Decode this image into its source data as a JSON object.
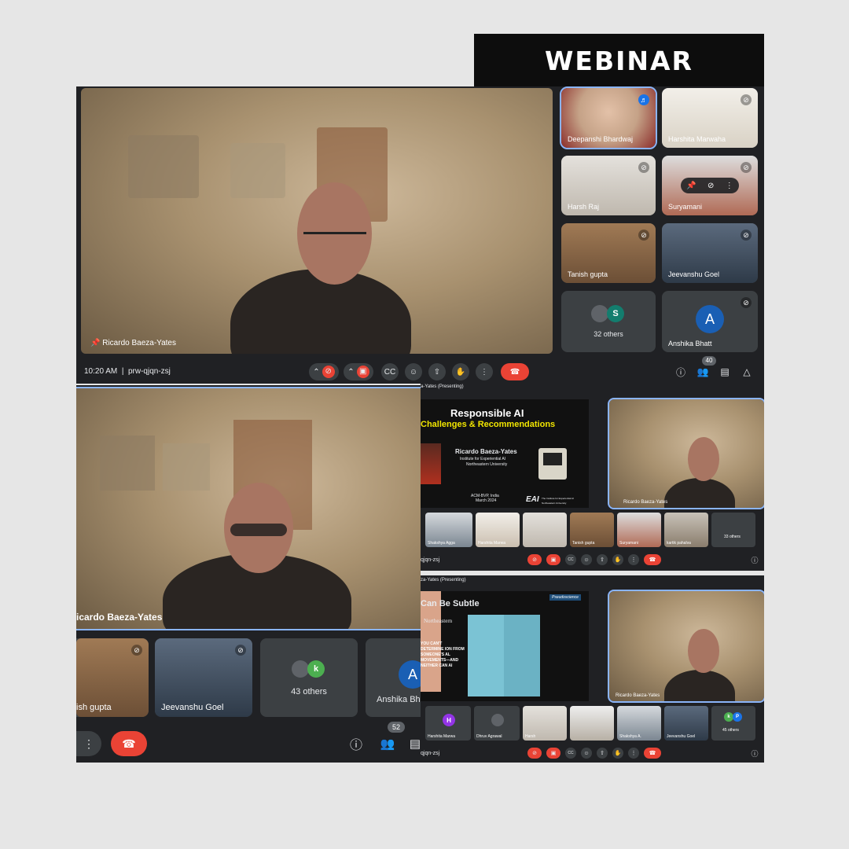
{
  "banner": {
    "title": "WEBINAR"
  },
  "top_panel": {
    "speaker_name": "Ricardo Baeza-Yates",
    "time": "10:20 AM",
    "meeting_code": "prw-qjqn-zsj",
    "participant_count": "40",
    "participants": [
      {
        "name": "Deepanshi Bhardwaj"
      },
      {
        "name": "Harshita Marwaha"
      },
      {
        "name": "Harsh Raj"
      },
      {
        "name": "Suryamani"
      },
      {
        "name": "Tanish gupta"
      },
      {
        "name": "Jeevanshu Goel"
      },
      {
        "name": "32 others",
        "initial": "S"
      },
      {
        "name": "Anshika Bhatt",
        "initial": "A"
      }
    ]
  },
  "left_panel": {
    "speaker_name": "icardo Baeza-Yates",
    "participants": [
      {
        "name": "ish gupta"
      },
      {
        "name": "Jeevanshu Goel"
      },
      {
        "name": "43 others",
        "initial": "k"
      },
      {
        "name": "Anshika Bh",
        "initial": "A"
      }
    ],
    "participant_count": "52"
  },
  "slide_panel_1": {
    "presenting_label": "a-Yates (Presenting)",
    "slide_title": "Responsible AI",
    "slide_subtitle": "Challenges & Recommendations",
    "author": "Ricardo Baeza-Yates",
    "affiliation_1": "Institute for Experiential AI",
    "affiliation_2": "Northeastern University",
    "event": "ACM-BVP, India",
    "date": "March 2024",
    "logo_text": "EAI",
    "logo_caption": "The Institute for Experiential AI",
    "logo_caption_2": "Northeastern University",
    "speaker_name": "Ricardo Baeza-Yates",
    "meeting_code": "qjqn-zsj",
    "strip": [
      "Shakshya Agga",
      "Harshita Marwa",
      "",
      "Tanish gupta",
      "Suryamani",
      "kartik pahalva",
      "33 others"
    ]
  },
  "slide_panel_2": {
    "presenting_label": "za-Yates (Presenting)",
    "slide_title": "Can Be Subtle",
    "tag": "Pseudoscience",
    "org": "Northeastern",
    "quote": "YOU CAN'T DETERMINE ION FROM SOMEONE'S AL MOVEMENTS—AND NEITHER CAN AI",
    "speaker_name": "Ricardo Baeza-Yates",
    "meeting_code": "qjqn-zsj",
    "strip": [
      "Harshita Marwa",
      "Dhruv Agrawal",
      "Harsh",
      "",
      "Shakshya A.",
      "Jeevanshu Goel",
      "45 others"
    ]
  },
  "colors": {
    "meet_bg": "#202124",
    "tile_bg": "#3c4043",
    "end_call": "#ea4335",
    "accent_blue": "#8ab4f8",
    "slide_yellow": "#f2e600"
  }
}
